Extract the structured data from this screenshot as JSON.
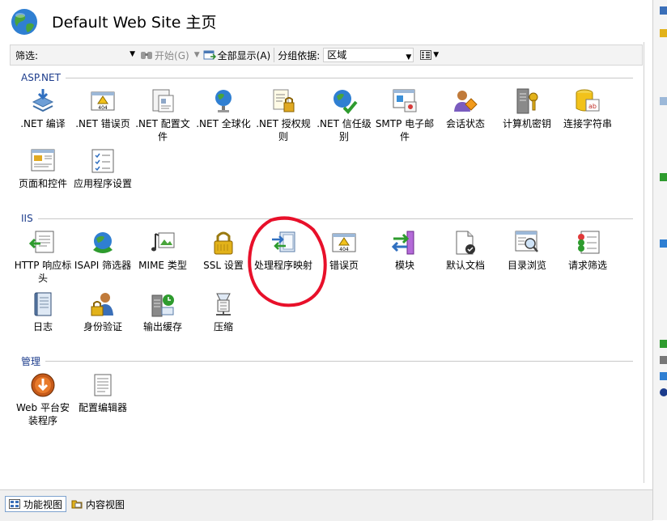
{
  "header": {
    "title": "Default Web Site 主页"
  },
  "toolbar": {
    "filter_label": "筛选:",
    "filter_value": "",
    "start_label": "开始(G)",
    "show_all_label": "全部显示(A)",
    "group_by_label": "分组依据:",
    "group_by_value": "区域"
  },
  "sections": [
    {
      "name": "ASP.NET",
      "items": [
        {
          "label": ".NET 编译",
          "icon": "net-compile-icon"
        },
        {
          "label": ".NET 错误页",
          "icon": "net-error-page-icon"
        },
        {
          "label": ".NET 配置文件",
          "icon": "net-profile-icon"
        },
        {
          "label": ".NET 全球化",
          "icon": "net-globalization-icon"
        },
        {
          "label": ".NET 授权规则",
          "icon": "net-authorization-icon"
        },
        {
          "label": ".NET 信任级别",
          "icon": "net-trust-level-icon"
        },
        {
          "label": "SMTP 电子邮件",
          "icon": "smtp-email-icon"
        },
        {
          "label": "会话状态",
          "icon": "session-state-icon"
        },
        {
          "label": "计算机密钥",
          "icon": "machine-key-icon"
        },
        {
          "label": "连接字符串",
          "icon": "connection-string-icon"
        },
        {
          "label": "页面和控件",
          "icon": "pages-controls-icon"
        },
        {
          "label": "应用程序设置",
          "icon": "app-settings-icon"
        }
      ]
    },
    {
      "name": "IIS",
      "items": [
        {
          "label": "HTTP 响应标头",
          "icon": "http-headers-icon"
        },
        {
          "label": "ISAPI 筛选器",
          "icon": "isapi-filters-icon"
        },
        {
          "label": "MIME 类型",
          "icon": "mime-types-icon"
        },
        {
          "label": "SSL 设置",
          "icon": "ssl-lock-icon"
        },
        {
          "label": "处理程序映射",
          "icon": "handler-mappings-icon"
        },
        {
          "label": "错误页",
          "icon": "error-pages-icon"
        },
        {
          "label": "模块",
          "icon": "modules-icon"
        },
        {
          "label": "默认文档",
          "icon": "default-document-icon"
        },
        {
          "label": "目录浏览",
          "icon": "directory-browsing-icon"
        },
        {
          "label": "请求筛选",
          "icon": "request-filtering-icon"
        },
        {
          "label": "日志",
          "icon": "logging-icon"
        },
        {
          "label": "身份验证",
          "icon": "authentication-icon"
        },
        {
          "label": "输出缓存",
          "icon": "output-caching-icon"
        },
        {
          "label": "压缩",
          "icon": "compression-icon"
        }
      ]
    },
    {
      "name": "管理",
      "items": [
        {
          "label": "Web 平台安装程序",
          "icon": "web-platform-installer-icon"
        },
        {
          "label": "配置编辑器",
          "icon": "configuration-editor-icon"
        }
      ]
    }
  ],
  "bottom_tabs": [
    {
      "label": "功能视图",
      "active": true
    },
    {
      "label": "内容视图",
      "active": false
    }
  ],
  "colors": {
    "section_header": "#1c3c8c",
    "annotation": "#e8102a",
    "active_tab_border": "#7da2ce"
  }
}
